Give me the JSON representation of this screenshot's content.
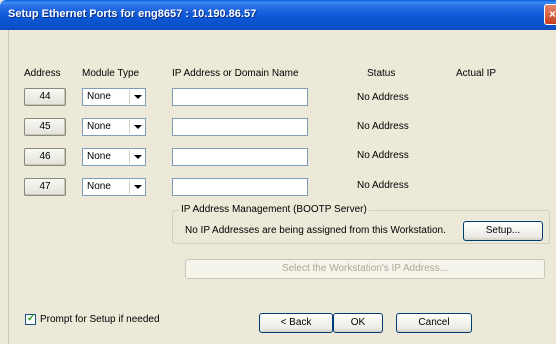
{
  "window": {
    "title": "Setup Ethernet Ports for eng8657 : 10.190.86.57",
    "close_glyph": "×"
  },
  "columns": {
    "address": "Address",
    "module_type": "Module Type",
    "ip": "IP Address or Domain Name",
    "status": "Status",
    "actual_ip": "Actual IP"
  },
  "ports": [
    {
      "address": "44",
      "module": "None",
      "ip": "",
      "status": "No Address"
    },
    {
      "address": "45",
      "module": "None",
      "ip": "",
      "status": "No Address"
    },
    {
      "address": "46",
      "module": "None",
      "ip": "",
      "status": "No Address"
    },
    {
      "address": "47",
      "module": "None",
      "ip": "",
      "status": "No Address"
    }
  ],
  "ip_management": {
    "legend": "IP Address Management (BOOTP Server)",
    "message": "No IP Addresses are being assigned from this Workstation.",
    "setup_label": "Setup...",
    "select_ws_label": "Select the Workstation's IP Address..."
  },
  "prompt": {
    "label": "Prompt for Setup if needed",
    "checked": true
  },
  "buttons": {
    "back": "< Back",
    "ok": "OK",
    "cancel": "Cancel"
  }
}
